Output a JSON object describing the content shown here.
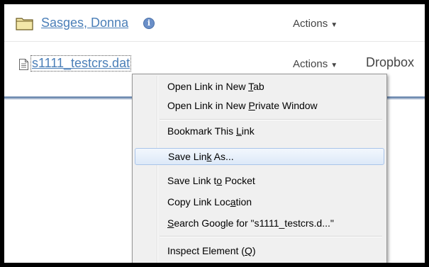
{
  "contact": {
    "name": "Sasges, Donna",
    "info_glyph": "i",
    "actions_label": "Actions"
  },
  "file": {
    "name": "s1111_testcrs.dat",
    "actions_label": "Actions",
    "dropbox_label": "Dropbox"
  },
  "context_menu": {
    "items": [
      {
        "pre": "Open Link in New ",
        "key": "T",
        "post": "ab"
      },
      {
        "pre": "Open Link in New ",
        "key": "P",
        "post": "rivate Window"
      },
      {
        "pre": "Bookmark This ",
        "key": "L",
        "post": "ink"
      },
      {
        "pre": "Save Lin",
        "key": "k",
        "post": " As..."
      },
      {
        "pre": "Save Link t",
        "key": "o",
        "post": " Pocket"
      },
      {
        "pre": "Copy Link Loc",
        "key": "a",
        "post": "tion"
      },
      {
        "pre": "",
        "key": "S",
        "post": "earch Google for \"s1111_testcrs.d...\""
      },
      {
        "pre": "Inspect Element (",
        "key": "Q",
        "post": ")"
      }
    ],
    "highlighted_index": 3
  },
  "colors": {
    "link": "#4b7fb8",
    "highlight_border": "#a9c4ea",
    "divider": "#5f7da6"
  }
}
